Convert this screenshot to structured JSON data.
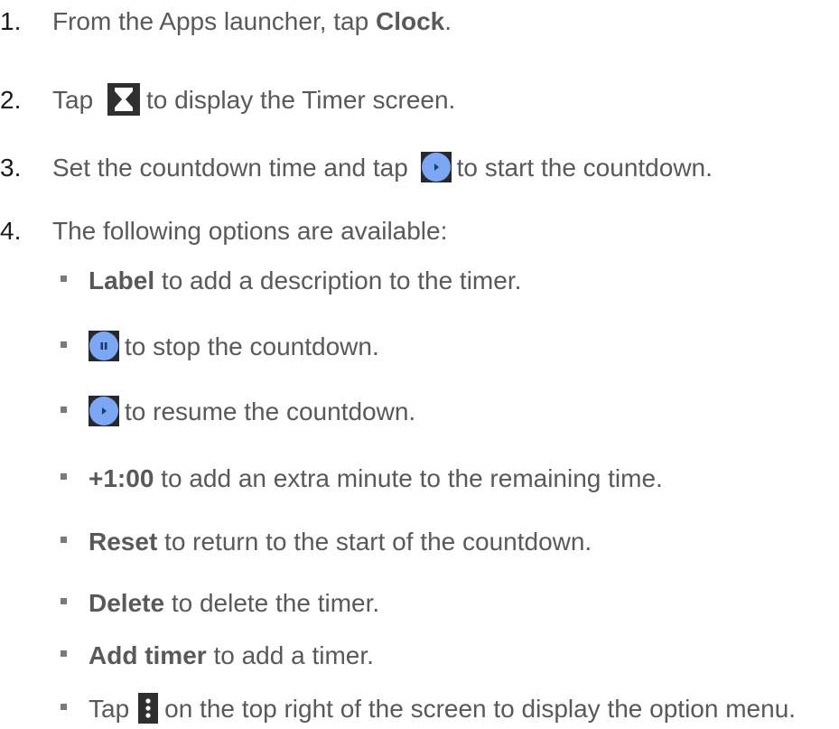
{
  "steps": [
    {
      "num": "1.",
      "before": "From the Apps launcher, tap ",
      "bold": "Clock",
      "after": "."
    },
    {
      "num": "2.",
      "before": "Tap",
      "after": "to display the Timer screen.",
      "icon": "hourglass-icon"
    },
    {
      "num": "3.",
      "before": "Set the countdown time and tap",
      "after": "to start the countdown.",
      "icon": "play-button-icon"
    },
    {
      "num": "4.",
      "text": "The following options are available:"
    }
  ],
  "options": [
    {
      "bold": "Label",
      "text": " to add a description to the timer."
    },
    {
      "icon": "pause-button-icon",
      "text": "to stop the countdown."
    },
    {
      "icon": "play-button-icon",
      "text": "to resume the countdown."
    },
    {
      "bold": "+1:00",
      "text": " to add an extra minute to the remaining time."
    },
    {
      "bold": "Reset",
      "text": " to return to the start of the countdown."
    },
    {
      "bold": "Delete",
      "text": " to delete the timer."
    },
    {
      "bold": "Add timer",
      "text": " to add a timer."
    },
    {
      "before": "Tap",
      "icon": "more-vert-icon",
      "text": "on the top right of the screen to display the option menu."
    }
  ],
  "colors": {
    "text": "#595959",
    "accent_button": "#7ba7f5",
    "icon_background": "#2f2f2f"
  }
}
